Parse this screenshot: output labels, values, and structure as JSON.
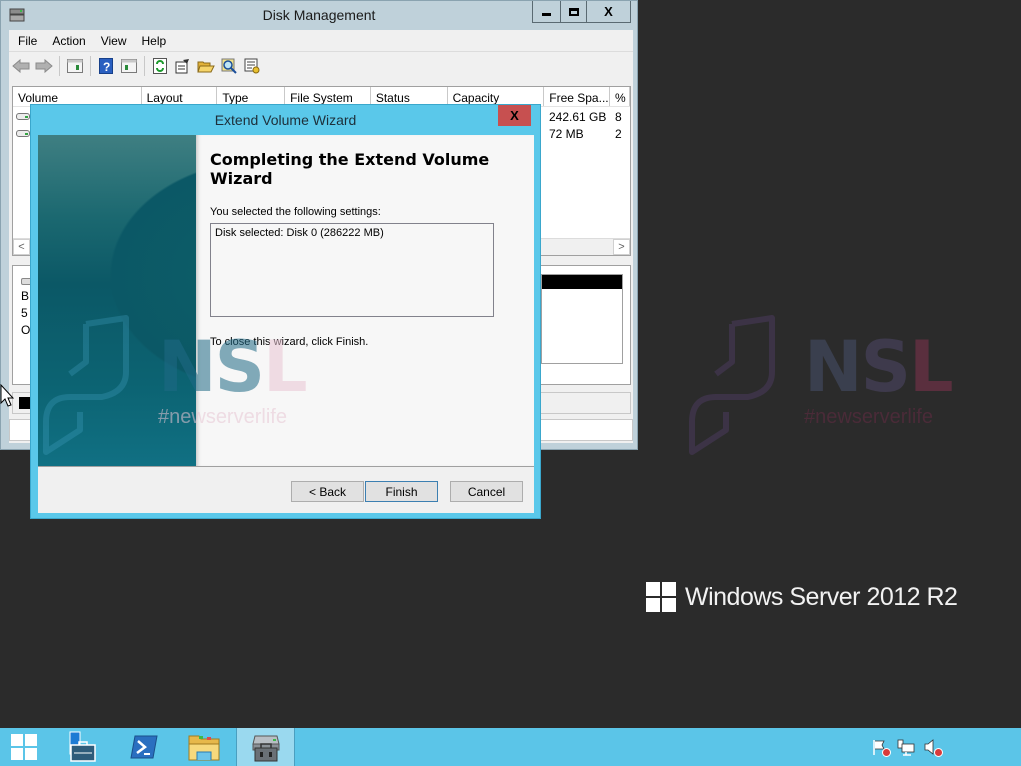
{
  "desktop": {
    "watermark": {
      "letters": [
        "N",
        "S",
        "L"
      ],
      "tagline": "#newserverlife"
    },
    "branding": "Windows Server 2012 R2"
  },
  "disk_management": {
    "title": "Disk Management",
    "window_controls": {
      "minimize": "minimize",
      "maximize": "maximize",
      "close": "X"
    },
    "menu": [
      "File",
      "Action",
      "View",
      "Help"
    ],
    "toolbar": [
      "back-icon",
      "forward-icon",
      "show-hide-console-tree-icon",
      "help-icon",
      "show-hide-action-pane-icon",
      "refresh-icon",
      "properties-icon",
      "open-icon",
      "search-icon",
      "settings-icon"
    ],
    "columns": [
      "Volume",
      "Layout",
      "Type",
      "File System",
      "Status",
      "Capacity",
      "Free Spa...",
      "%"
    ],
    "rows": [
      {
        "free_space": "242.61 GB",
        "percent": "8"
      },
      {
        "free_space": "72 MB",
        "percent": "2"
      }
    ],
    "scroll_left": "<",
    "scroll_right": ">",
    "disk_info_lines": [
      "B",
      "5",
      "O"
    ]
  },
  "wizard": {
    "title": "Extend Volume Wizard",
    "close": "X",
    "heading": "Completing the Extend Volume Wizard",
    "settings_label": "You selected the following settings:",
    "settings_text": "Disk selected: Disk 0 (286222 MB)",
    "hint": "To close this wizard, click Finish.",
    "buttons": {
      "back": "< Back",
      "finish": "Finish",
      "cancel": "Cancel"
    }
  },
  "taskbar": {
    "items": [
      "start-button",
      "server-manager",
      "powershell",
      "file-explorer",
      "computer-management"
    ],
    "active": "computer-management",
    "tray": [
      "action-center-icon",
      "network-icon",
      "volume-icon"
    ]
  },
  "colors": {
    "taskbar": "#5bc5e8",
    "wizard_frame": "#5ac8ea",
    "close_red": "#c75050",
    "desktop": "#2b2b2b"
  }
}
